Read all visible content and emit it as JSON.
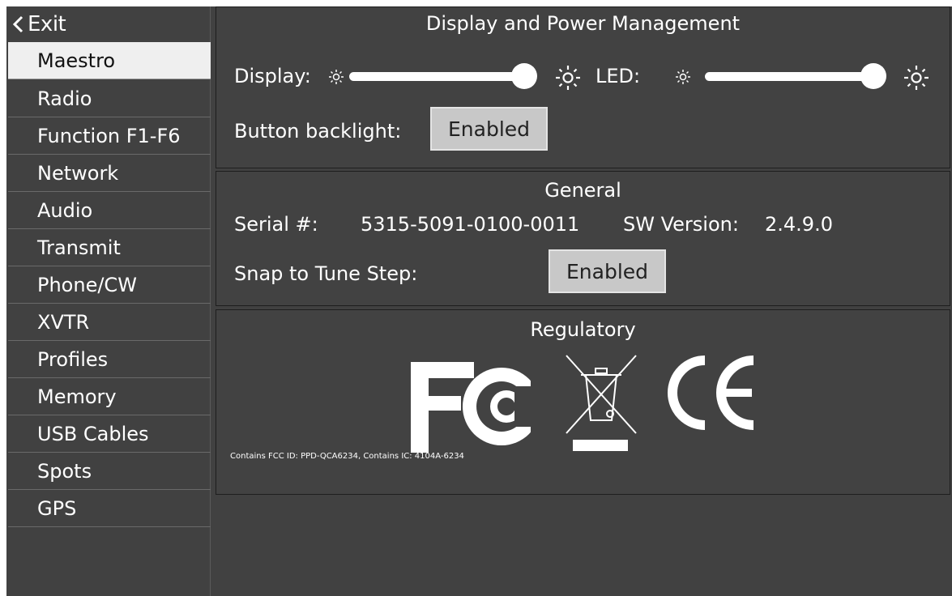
{
  "sidebar": {
    "exit_label": "Exit",
    "items": [
      {
        "label": "Maestro",
        "selected": true
      },
      {
        "label": "Radio"
      },
      {
        "label": "Function F1-F6"
      },
      {
        "label": "Network"
      },
      {
        "label": "Audio"
      },
      {
        "label": "Transmit"
      },
      {
        "label": "Phone/CW"
      },
      {
        "label": "XVTR"
      },
      {
        "label": "Profiles"
      },
      {
        "label": "Memory"
      },
      {
        "label": "USB Cables"
      },
      {
        "label": "Spots"
      },
      {
        "label": "GPS"
      }
    ]
  },
  "display_power": {
    "title": "Display and Power Management",
    "display_label": "Display:",
    "display_level": 1.0,
    "led_label": "LED:",
    "led_level": 1.0,
    "backlight_label": "Button backlight:",
    "backlight_value": "Enabled",
    "icons": {
      "dim": "sun-small-icon",
      "bright": "sun-large-icon"
    }
  },
  "general": {
    "title": "General",
    "serial_label": "Serial #:",
    "serial_value": "5315-5091-0100-0011",
    "sw_label": "SW Version:",
    "sw_value": "2.4.9.0",
    "snap_label": "Snap to Tune Step:",
    "snap_value": "Enabled"
  },
  "regulatory": {
    "title": "Regulatory",
    "fcc_text": "Contains FCC ID: PPD-QCA6234, Contains IC: 4104A-6234",
    "logos": [
      "fcc-logo",
      "weee-bin-icon",
      "ce-logo"
    ]
  },
  "colors": {
    "background": "#414141",
    "panel_border": "#1e1e1e",
    "button_bg": "#c8c8c8",
    "selected_bg": "#efefef",
    "text": "#ffffff"
  }
}
